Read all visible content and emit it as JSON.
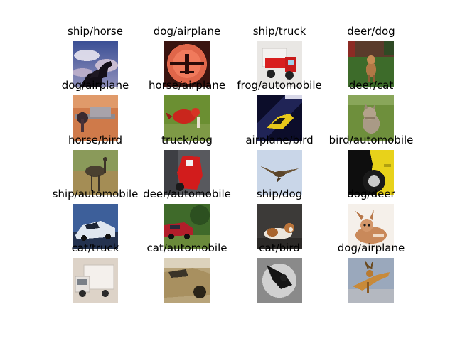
{
  "figure": {
    "panels": [
      {
        "title": "ship/horse",
        "picture": "horse-silhouette-against-cloudy-sky"
      },
      {
        "title": "dog/airplane",
        "picture": "airplane-silhouette-against-orange-sun"
      },
      {
        "title": "ship/truck",
        "picture": "red-and-white-toy-truck"
      },
      {
        "title": "deer/dog",
        "picture": "dog-standing-on-grass"
      },
      {
        "title": "dog/airplane",
        "picture": "propeller-airplane-on-orange-ground"
      },
      {
        "title": "horse/airplane",
        "picture": "red-bird-on-green-background"
      },
      {
        "title": "frog/automobile",
        "picture": "yellow-sports-car-on-dark-background"
      },
      {
        "title": "deer/cat",
        "picture": "cat-in-green-grass"
      },
      {
        "title": "horse/bird",
        "picture": "ostrich-in-dry-field"
      },
      {
        "title": "truck/dog",
        "picture": "red-toy-on-grey-background"
      },
      {
        "title": "airplane/bird",
        "picture": "bird-flying-in-pale-sky"
      },
      {
        "title": "bird/automobile",
        "picture": "yellow-car-wheel-close-up"
      },
      {
        "title": "ship/automobile",
        "picture": "white-sports-car-on-blue-background"
      },
      {
        "title": "deer/automobile",
        "picture": "red-car-among-trees"
      },
      {
        "title": "ship/dog",
        "picture": "dog-lying-on-dark-floor"
      },
      {
        "title": "dog/deer",
        "picture": "fawn-lying-on-white-background"
      },
      {
        "title": "cat/truck",
        "picture": "white-truck-on-pale-background"
      },
      {
        "title": "cat/automobile",
        "picture": "gold-car-close-up"
      },
      {
        "title": "cat/bird",
        "picture": "black-bird-on-grey-background"
      },
      {
        "title": "dog/airplane",
        "picture": "orange-deer-on-blue-grey-background"
      }
    ]
  }
}
